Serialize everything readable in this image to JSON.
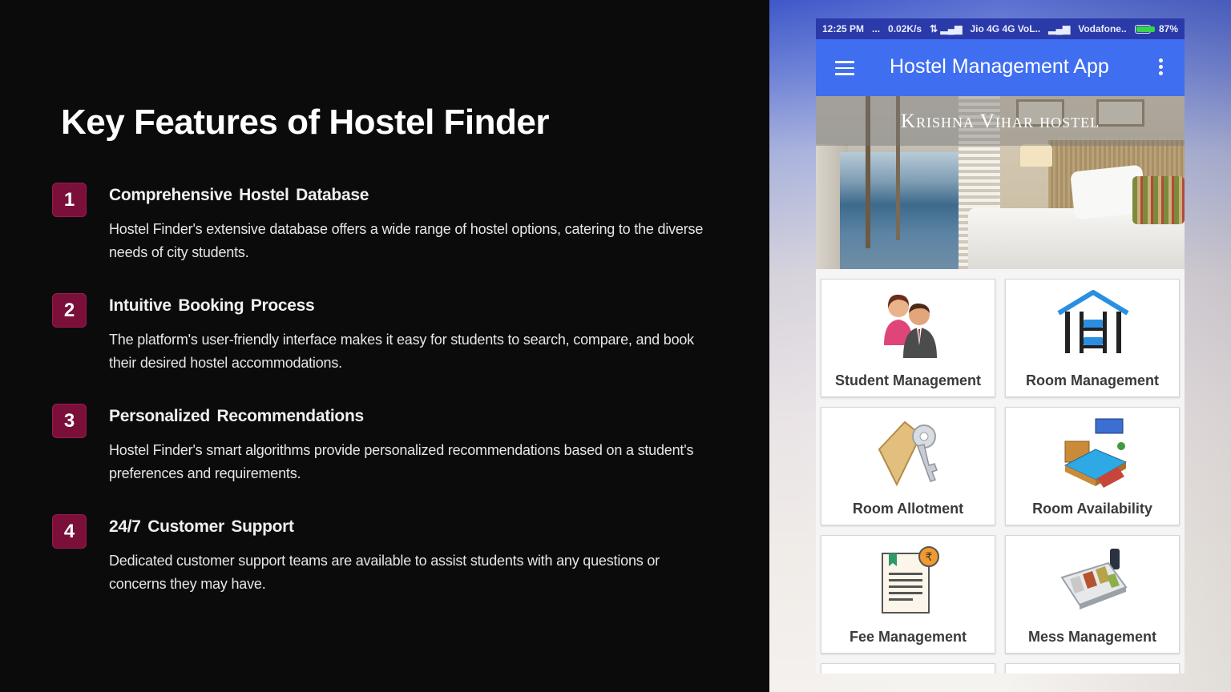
{
  "slide": {
    "title": "Key Features of Hostel Finder",
    "features": [
      {
        "number": "1",
        "title": "Comprehensive  Hostel  Database",
        "description": "Hostel Finder's extensive database offers a wide range of hostel options, catering to the diverse needs of city students."
      },
      {
        "number": "2",
        "title": "Intuitive  Booking  Process",
        "description": "The platform's user-friendly interface makes it easy for students to search, compare, and book their  desired hostel accommodations."
      },
      {
        "number": "3",
        "title": "Personalized  Recommendations",
        "description": "Hostel Finder's smart algorithms provide personalized recommendations based on a student's preferences and requirements."
      },
      {
        "number": "4",
        "title": "24/7  Customer  Support",
        "description": "Dedicated customer support teams are available to assist students with  any  questions or concerns they may have."
      }
    ],
    "accent_color": "#7a0f3a"
  },
  "phone": {
    "status_bar": {
      "time": "12:25 PM",
      "dots": "...",
      "speed": "0.02K/s",
      "carrier1": "Jio 4G 4G VoL..",
      "carrier2": "Vodafone..",
      "battery": "87%",
      "battery_level": 0.87
    },
    "app_bar": {
      "title": "Hostel Management App",
      "color": "#3f6ef0",
      "menu_icon": "hamburger-menu-icon",
      "more_icon": "more-vert-icon"
    },
    "banner": {
      "title": "Krishna Vihar hostel"
    },
    "tiles": [
      {
        "label": "Student Management",
        "icon": "student-management-icon"
      },
      {
        "label": "Room Management",
        "icon": "room-management-icon"
      },
      {
        "label": "Room Allotment",
        "icon": "room-allotment-icon"
      },
      {
        "label": "Room Availability",
        "icon": "room-availability-icon"
      },
      {
        "label": "Fee Management",
        "icon": "fee-management-icon"
      },
      {
        "label": "Mess Management",
        "icon": "mess-management-icon"
      }
    ]
  }
}
